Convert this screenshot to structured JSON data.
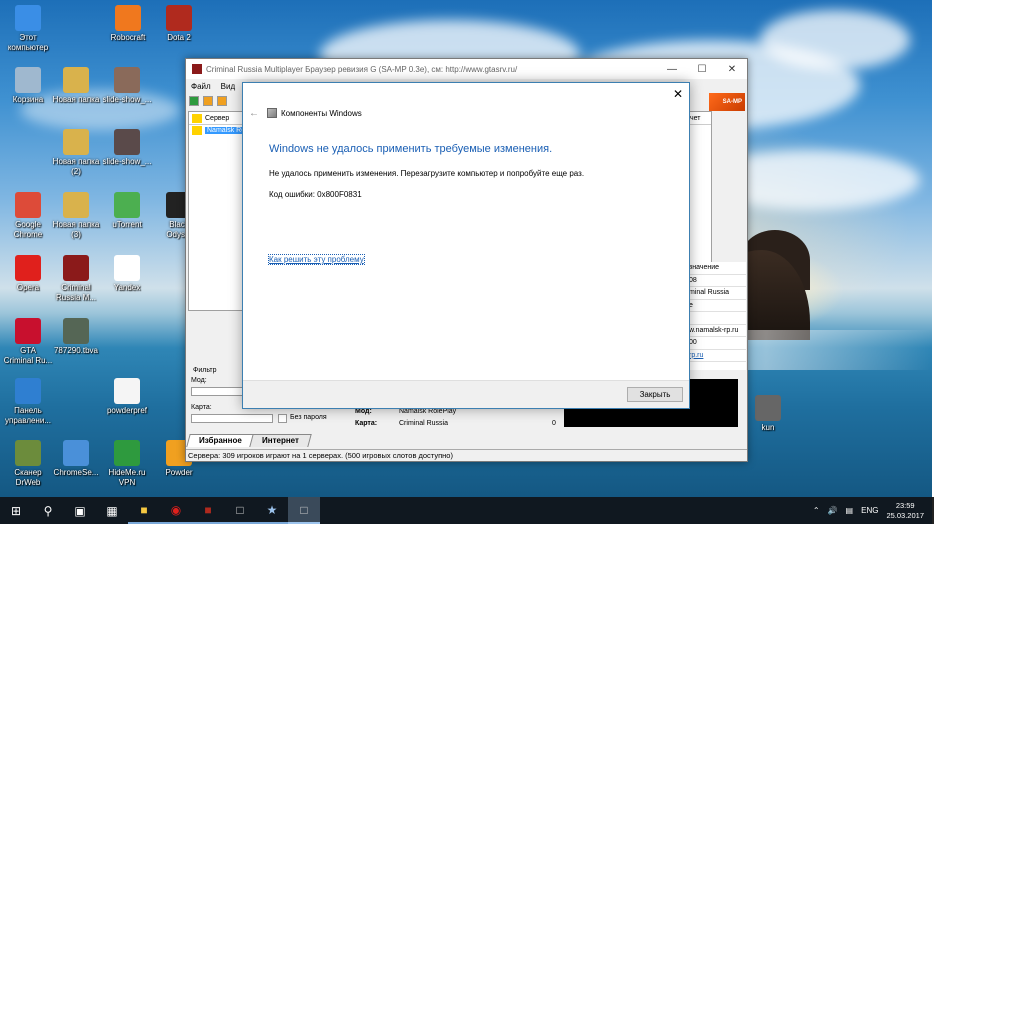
{
  "desktop": {
    "icons": [
      {
        "label": "Этот\nкомпьютер",
        "icon": "computer-icon",
        "color": "#3a8ee6"
      },
      {
        "label": "Robocraft",
        "icon": "robocraft-icon",
        "color": "#f0781e"
      },
      {
        "label": "Dota 2",
        "icon": "dota2-icon",
        "color": "#b02a1e"
      },
      {
        "label": "Корзина",
        "icon": "recycle-bin-icon",
        "color": "#9fb8cf"
      },
      {
        "label": "Новая папка",
        "icon": "folder-icon",
        "color": "#d9b24c"
      },
      {
        "label": "slide-show_...",
        "icon": "image-file-icon",
        "color": "#8a6a5a"
      },
      {
        "label": "Новая папка\n(2)",
        "icon": "folder-icon",
        "color": "#d9b24c"
      },
      {
        "label": "slide-show_...",
        "icon": "image-file-icon",
        "color": "#5a4a4a"
      },
      {
        "label": "Google\nChrome",
        "icon": "chrome-icon",
        "color": "#dd4b39"
      },
      {
        "label": "Новая папка\n(3)",
        "icon": "folder-icon",
        "color": "#d9b24c"
      },
      {
        "label": "uTorrent",
        "icon": "utorrent-icon",
        "color": "#4caf50"
      },
      {
        "label": "Black\nOdys...",
        "icon": "game-icon",
        "color": "#222222"
      },
      {
        "label": "Opera",
        "icon": "opera-icon",
        "color": "#e0201c"
      },
      {
        "label": "Criminal\nRussia M...",
        "icon": "criminal-russia-icon",
        "color": "#8b1a1a"
      },
      {
        "label": "Yandex",
        "icon": "yandex-icon",
        "color": "#ffffff"
      },
      {
        "label": "GTA\nCriminal Ru...",
        "icon": "gta-icon",
        "color": "#c8102e"
      },
      {
        "label": "787290.tbva",
        "icon": "file-icon",
        "color": "#556655"
      },
      {
        "label": "Панель\nуправлени...",
        "icon": "control-panel-icon",
        "color": "#2f7fd1"
      },
      {
        "label": "powderpref",
        "icon": "document-icon",
        "color": "#f5f5f5"
      },
      {
        "label": "Сканер\nDrWeb",
        "icon": "drweb-icon",
        "color": "#6c8c3c"
      },
      {
        "label": "ChromeSe...",
        "icon": "chromesetup-icon",
        "color": "#4a90d9"
      },
      {
        "label": "HideMe.ru\nVPN",
        "icon": "vpn-icon",
        "color": "#2e9a3e"
      },
      {
        "label": "Powder",
        "icon": "powder-icon",
        "color": "#f0a020"
      },
      {
        "label": "kun",
        "icon": "file-icon",
        "color": "#666666"
      }
    ]
  },
  "app": {
    "title": "Criminal Russia Multiplayer Браузер ревизия G (SA-MP 0.3e), см: http://www.gtasrv.ru/",
    "menu": [
      "Файл",
      "Вид"
    ],
    "logo_text": "SA-MP",
    "columns": {
      "server": "Сервер",
      "score": "Счет"
    },
    "selected_server": "Namalsk Rol",
    "info_values": [
      "значение",
      "08",
      "minal Russia",
      "e",
      "",
      "w.namalsk-rp.ru",
      "00",
      "rp.ru"
    ],
    "filter": {
      "title": "Фильтр",
      "mod_label": "Мод:",
      "map_label": "Карта:",
      "no_password": "Без пароля"
    },
    "details": {
      "mod_key": "Мод:",
      "mod_val": "Namalsk RolePlay",
      "map_key": "Карта:",
      "map_val": "Criminal Russia",
      "side_val": "0"
    },
    "tabs": [
      "Избранное",
      "Интернет"
    ],
    "status": "Сервера: 309 игроков играют на 1 серверах. (500 игровых слотов доступно)"
  },
  "dialog": {
    "header": "Компоненты Windows",
    "title": "Windows не удалось применить требуемые изменения.",
    "message": "Не удалось применить изменения. Перезагрузите компьютер и попробуйте еще раз.",
    "error_code": "Код ошибки: 0x800F0831",
    "link": "Как решить эту проблему",
    "close_button": "Закрыть"
  },
  "taskbar": {
    "language": "ENG",
    "time": "23:59",
    "date": "25.03.2017"
  }
}
